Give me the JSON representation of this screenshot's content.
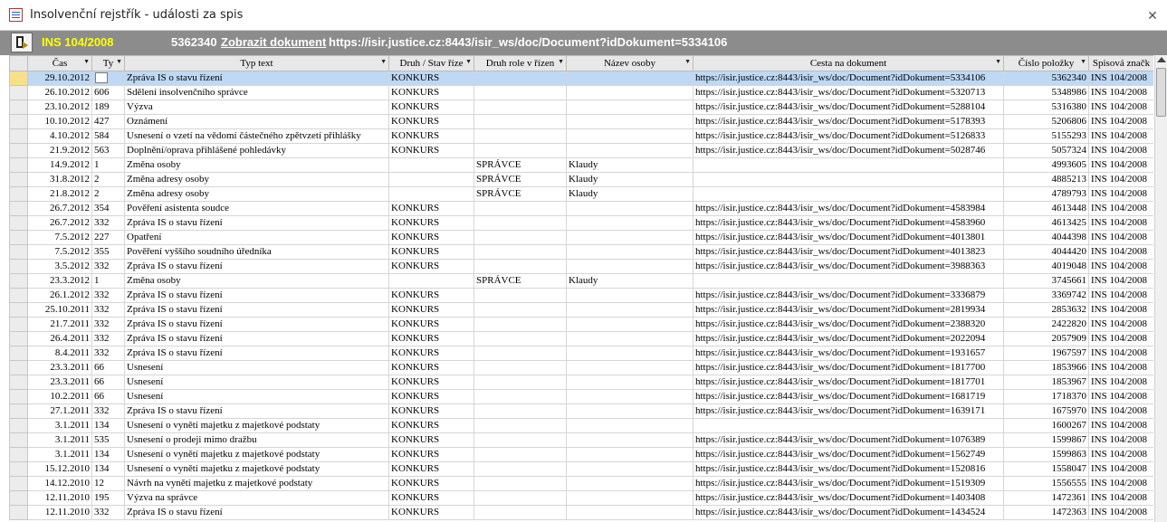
{
  "window": {
    "title": "Insolvenční rejstřík - události za spis"
  },
  "header": {
    "spis": "INS 104/2008",
    "document_id": "5362340",
    "show_document_label": "Zobrazit dokument",
    "url": "https://isir.justice.cz:8443/isir_ws/doc/Document?idDokument=5334106"
  },
  "columns": [
    "Čas",
    "Ty",
    "Typ text",
    "Druh / Stav říze",
    "Druh role v řízen",
    "Název osoby",
    "Cesta na dokument",
    "Číslo položky",
    "Spisová značk"
  ],
  "rows": [
    [
      "29.10.2012",
      "",
      "Zpráva IS o stavu řízení",
      "KONKURS",
      "",
      "",
      "https://isir.justice.cz:8443/isir_ws/doc/Document?idDokument=5334106",
      "5362340",
      "INS 104/2008"
    ],
    [
      "26.10.2012",
      "606",
      "Sdělení insolvenčního správce",
      "KONKURS",
      "",
      "",
      "https://isir.justice.cz:8443/isir_ws/doc/Document?idDokument=5320713",
      "5348986",
      "INS 104/2008"
    ],
    [
      "23.10.2012",
      "189",
      "Výzva",
      "KONKURS",
      "",
      "",
      "https://isir.justice.cz:8443/isir_ws/doc/Document?idDokument=5288104",
      "5316380",
      "INS 104/2008"
    ],
    [
      "10.10.2012",
      "427",
      "Oznámení",
      "KONKURS",
      "",
      "",
      "https://isir.justice.cz:8443/isir_ws/doc/Document?idDokument=5178393",
      "5206806",
      "INS 104/2008"
    ],
    [
      "4.10.2012",
      "584",
      "Usnesení o vzetí na vědomí částečného zpětvzetí přihlášky",
      "KONKURS",
      "",
      "",
      "https://isir.justice.cz:8443/isir_ws/doc/Document?idDokument=5126833",
      "5155293",
      "INS 104/2008"
    ],
    [
      "21.9.2012",
      "563",
      "Doplnění/oprava přihlášené pohledávky",
      "KONKURS",
      "",
      "",
      "https://isir.justice.cz:8443/isir_ws/doc/Document?idDokument=5028746",
      "5057324",
      "INS 104/2008"
    ],
    [
      "14.9.2012",
      "1",
      "Změna osoby",
      "",
      "SPRÁVCE",
      "Klaudy",
      "",
      "4993605",
      "INS 104/2008"
    ],
    [
      "31.8.2012",
      "2",
      "Změna adresy osoby",
      "",
      "SPRÁVCE",
      "Klaudy",
      "",
      "4885213",
      "INS 104/2008"
    ],
    [
      "21.8.2012",
      "2",
      "Změna adresy osoby",
      "",
      "SPRÁVCE",
      "Klaudy",
      "",
      "4789793",
      "INS 104/2008"
    ],
    [
      "26.7.2012",
      "354",
      "Pověření asistenta soudce",
      "KONKURS",
      "",
      "",
      "https://isir.justice.cz:8443/isir_ws/doc/Document?idDokument=4583984",
      "4613448",
      "INS 104/2008"
    ],
    [
      "26.7.2012",
      "332",
      "Zpráva IS o stavu řízení",
      "KONKURS",
      "",
      "",
      "https://isir.justice.cz:8443/isir_ws/doc/Document?idDokument=4583960",
      "4613425",
      "INS 104/2008"
    ],
    [
      "7.5.2012",
      "227",
      "Opatření",
      "KONKURS",
      "",
      "",
      "https://isir.justice.cz:8443/isir_ws/doc/Document?idDokument=4013801",
      "4044398",
      "INS 104/2008"
    ],
    [
      "7.5.2012",
      "355",
      "Pověření vyššího soudního úředníka",
      "KONKURS",
      "",
      "",
      "https://isir.justice.cz:8443/isir_ws/doc/Document?idDokument=4013823",
      "4044420",
      "INS 104/2008"
    ],
    [
      "3.5.2012",
      "332",
      "Zpráva IS o stavu řízení",
      "KONKURS",
      "",
      "",
      "https://isir.justice.cz:8443/isir_ws/doc/Document?idDokument=3988363",
      "4019048",
      "INS 104/2008"
    ],
    [
      "23.3.2012",
      "1",
      "Změna osoby",
      "",
      "SPRÁVCE",
      "Klaudy",
      "",
      "3745661",
      "INS 104/2008"
    ],
    [
      "26.1.2012",
      "332",
      "Zpráva IS o stavu řízení",
      "KONKURS",
      "",
      "",
      "https://isir.justice.cz:8443/isir_ws/doc/Document?idDokument=3336879",
      "3369742",
      "INS 104/2008"
    ],
    [
      "25.10.2011",
      "332",
      "Zpráva IS o stavu řízení",
      "KONKURS",
      "",
      "",
      "https://isir.justice.cz:8443/isir_ws/doc/Document?idDokument=2819934",
      "2853632",
      "INS 104/2008"
    ],
    [
      "21.7.2011",
      "332",
      "Zpráva IS o stavu řízení",
      "KONKURS",
      "",
      "",
      "https://isir.justice.cz:8443/isir_ws/doc/Document?idDokument=2388320",
      "2422820",
      "INS 104/2008"
    ],
    [
      "26.4.2011",
      "332",
      "Zpráva IS o stavu řízení",
      "KONKURS",
      "",
      "",
      "https://isir.justice.cz:8443/isir_ws/doc/Document?idDokument=2022094",
      "2057909",
      "INS 104/2008"
    ],
    [
      "8.4.2011",
      "332",
      "Zpráva IS o stavu řízení",
      "KONKURS",
      "",
      "",
      "https://isir.justice.cz:8443/isir_ws/doc/Document?idDokument=1931657",
      "1967597",
      "INS 104/2008"
    ],
    [
      "23.3.2011",
      "66",
      "Usnesení",
      "KONKURS",
      "",
      "",
      "https://isir.justice.cz:8443/isir_ws/doc/Document?idDokument=1817700",
      "1853966",
      "INS 104/2008"
    ],
    [
      "23.3.2011",
      "66",
      "Usnesení",
      "KONKURS",
      "",
      "",
      "https://isir.justice.cz:8443/isir_ws/doc/Document?idDokument=1817701",
      "1853967",
      "INS 104/2008"
    ],
    [
      "10.2.2011",
      "66",
      "Usnesení",
      "KONKURS",
      "",
      "",
      "https://isir.justice.cz:8443/isir_ws/doc/Document?idDokument=1681719",
      "1718370",
      "INS 104/2008"
    ],
    [
      "27.1.2011",
      "332",
      "Zpráva IS o stavu řízení",
      "KONKURS",
      "",
      "",
      "https://isir.justice.cz:8443/isir_ws/doc/Document?idDokument=1639171",
      "1675970",
      "INS 104/2008"
    ],
    [
      "3.1.2011",
      "134",
      "Usnesení o vynětí majetku z majetkové podstaty",
      "KONKURS",
      "",
      "",
      "",
      "1600267",
      "INS 104/2008"
    ],
    [
      "3.1.2011",
      "535",
      "Usnesení o prodeji mimo dražbu",
      "KONKURS",
      "",
      "",
      "https://isir.justice.cz:8443/isir_ws/doc/Document?idDokument=1076389",
      "1599867",
      "INS 104/2008"
    ],
    [
      "3.1.2011",
      "134",
      "Usnesení o vynětí majetku z majetkové podstaty",
      "KONKURS",
      "",
      "",
      "https://isir.justice.cz:8443/isir_ws/doc/Document?idDokument=1562749",
      "1599863",
      "INS 104/2008"
    ],
    [
      "15.12.2010",
      "134",
      "Usnesení o vynětí majetku z majetkové podstaty",
      "KONKURS",
      "",
      "",
      "https://isir.justice.cz:8443/isir_ws/doc/Document?idDokument=1520816",
      "1558047",
      "INS 104/2008"
    ],
    [
      "14.12.2010",
      "12",
      "Návrh na vynětí majetku z majetkové podstaty",
      "KONKURS",
      "",
      "",
      "https://isir.justice.cz:8443/isir_ws/doc/Document?idDokument=1519309",
      "1556555",
      "INS 104/2008"
    ],
    [
      "12.11.2010",
      "195",
      "Výzva na správce",
      "KONKURS",
      "",
      "",
      "https://isir.justice.cz:8443/isir_ws/doc/Document?idDokument=1403408",
      "1472361",
      "INS 104/2008"
    ],
    [
      "12.11.2010",
      "332",
      "Zpráva IS o stavu řízení",
      "KONKURS",
      "",
      "",
      "https://isir.justice.cz:8443/isir_ws/doc/Document?idDokument=1434524",
      "1472363",
      "INS 104/2008"
    ]
  ]
}
